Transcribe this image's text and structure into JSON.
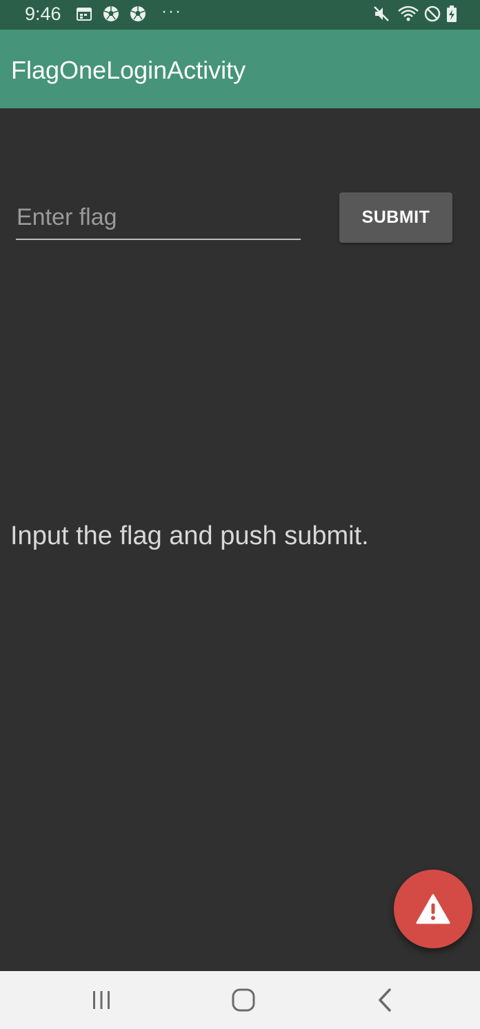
{
  "status_bar": {
    "time": "9:46",
    "icons": [
      "calendar-icon",
      "soccer-ball-icon",
      "soccer-ball-icon",
      "more-dots-icon",
      "mute-icon",
      "wifi-icon",
      "do-not-disturb-icon",
      "battery-charging-icon"
    ],
    "dots": "···"
  },
  "app_bar": {
    "title": "FlagOneLoginActivity",
    "color": "#46947a"
  },
  "form": {
    "input_placeholder": "Enter flag",
    "input_value": "",
    "submit_label": "SUBMIT"
  },
  "instruction": "Input the flag and push submit.",
  "fab": {
    "icon": "warning-icon",
    "color": "#d44b45"
  },
  "nav_bar": {
    "buttons": [
      "recents-icon",
      "home-icon",
      "back-icon"
    ]
  },
  "colors": {
    "background": "#303030",
    "status_bar": "#2b5f49",
    "button": "#585858"
  }
}
